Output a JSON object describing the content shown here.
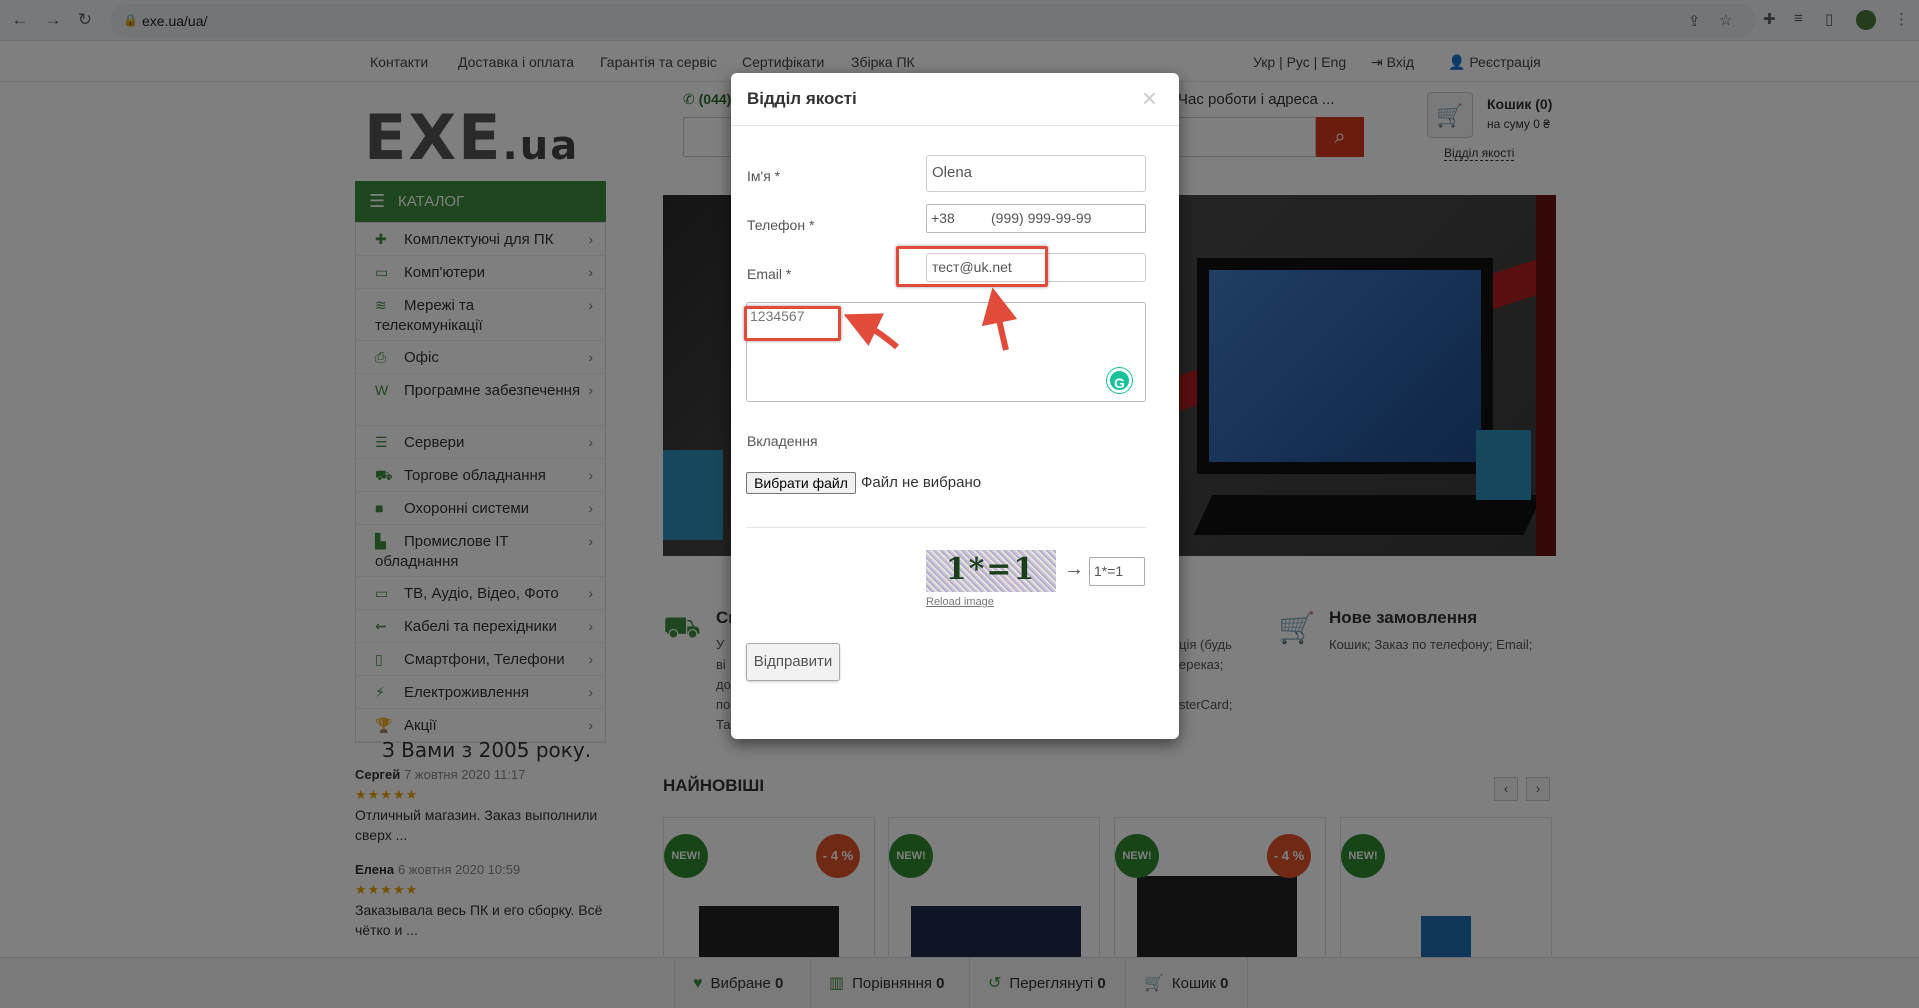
{
  "browser": {
    "url": "exe.ua/ua/"
  },
  "topnav": {
    "links": [
      "Контакти",
      "Доставка і оплата",
      "Гарантія та сервіс",
      "Сертифікати",
      "Збірка ПК"
    ],
    "lang": "Укр | Рус | Eng",
    "login": "Вхід",
    "register": "Реєстрація"
  },
  "header": {
    "logo_main": "EXE",
    "logo_tld": ".ua",
    "phone": "(044)",
    "hours": "Час роботи і адреса ...",
    "cart_title": "Кошик (0)",
    "cart_sum": "на суму 0 ₴",
    "quality_link": "Відділ якості"
  },
  "catalog": {
    "title": "КАТАЛОГ",
    "items": [
      {
        "label": "Комплектуючі для ПК",
        "icon": "puzzle-icon"
      },
      {
        "label": "Комп'ютери",
        "icon": "laptop-icon"
      },
      {
        "label": "Мережі та телекомунікації",
        "icon": "wifi-icon"
      },
      {
        "label": "Офіс",
        "icon": "printer-icon"
      },
      {
        "label": "Програмне забезпечення",
        "icon": "word-file-icon"
      },
      {
        "label": "Сервери",
        "icon": "server-icon"
      },
      {
        "label": "Торгове обладнання",
        "icon": "cart-icon"
      },
      {
        "label": "Охоронні системи",
        "icon": "camera-icon"
      },
      {
        "label": "Промислове IT обладнання",
        "icon": "industry-icon"
      },
      {
        "label": "ТВ, Аудіо, Відео, Фото",
        "icon": "monitor-icon"
      },
      {
        "label": "Кабелі та перехідники",
        "icon": "usb-icon"
      },
      {
        "label": "Смартфони, Телефони",
        "icon": "phone-icon"
      },
      {
        "label": "Електроживлення",
        "icon": "plug-icon"
      },
      {
        "label": "Акції",
        "icon": "trophy-icon"
      }
    ]
  },
  "reviews": {
    "title": "З Вами з 2005 року.",
    "items": [
      {
        "name": "Сергей",
        "date": "7 жовтня 2020 11:17",
        "stars": "★★★★★",
        "text": "Отличный магазин. Заказ выполнили сверх ..."
      },
      {
        "name": "Елена",
        "date": "6 жовтня 2020 10:59",
        "stars": "★★★★★",
        "text": "Заказывала весь ПК и его сборку. Всё чётко и ..."
      }
    ]
  },
  "features": {
    "left_title": "Сп",
    "left_text_lines": [
      "У",
      "ві",
      "до",
      "по",
      "Та"
    ],
    "mid_text_lines": [
      "ція (будь",
      "ереказ;",
      "sterCard;"
    ],
    "right_title": "Нове замовлення",
    "right_text": "Кошик; Заказ по телефону; Email;"
  },
  "products": {
    "section_title": "НАЙНОВІШІ",
    "cards": [
      {
        "badge": "NEW!",
        "sale": "- 4 %"
      },
      {
        "badge": "NEW!",
        "sale": ""
      },
      {
        "badge": "NEW!",
        "sale": "- 4 %"
      },
      {
        "badge": "NEW!",
        "sale": ""
      }
    ]
  },
  "bottombar": {
    "wishlist": "Вибране",
    "wishlist_count": "0",
    "compare": "Порівняння",
    "compare_count": "0",
    "viewed": "Переглянуті",
    "viewed_count": "0",
    "cart": "Кошик",
    "cart_count": "0"
  },
  "modal": {
    "title": "Відділ якості",
    "close": "×",
    "name_label": "Ім'я *",
    "name_value": "Olena",
    "phone_label": "Телефон *",
    "phone_prefix": "+38",
    "phone_mask": "(999) 999-99-99",
    "email_label": "Email *",
    "email_value": "тест@uk.net",
    "message_value": "1234567",
    "attachment_label": "Вкладення",
    "file_button": "Вибрати файл",
    "file_status": "Файл не вибрано",
    "captcha_text": "1*=1",
    "reload_label": "Reload image",
    "captcha_arrow": "→",
    "captcha_answer": "1*=1",
    "submit": "Відправити"
  },
  "colors": {
    "brand_green": "#3f8f3f",
    "search_red": "#d9381e",
    "highlight_red": "#e24a3a"
  }
}
